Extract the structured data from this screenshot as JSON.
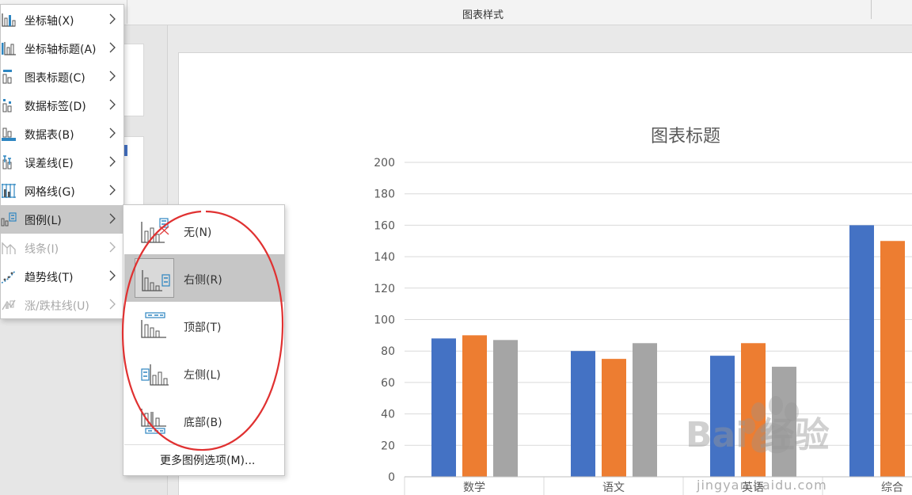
{
  "ribbon": {
    "group_label": "图表样式"
  },
  "menu": {
    "items": [
      {
        "label": "坐标轴(X)",
        "icon": "axis-icon",
        "state": "normal"
      },
      {
        "label": "坐标轴标题(A)",
        "icon": "axis-title-icon",
        "state": "normal"
      },
      {
        "label": "图表标题(C)",
        "icon": "chart-title-icon",
        "state": "normal"
      },
      {
        "label": "数据标签(D)",
        "icon": "data-labels-icon",
        "state": "normal"
      },
      {
        "label": "数据表(B)",
        "icon": "data-table-icon",
        "state": "normal"
      },
      {
        "label": "误差线(E)",
        "icon": "error-bars-icon",
        "state": "normal"
      },
      {
        "label": "网格线(G)",
        "icon": "gridlines-icon",
        "state": "normal"
      },
      {
        "label": "图例(L)",
        "icon": "legend-icon",
        "state": "active"
      },
      {
        "label": "线条(I)",
        "icon": "lines-icon",
        "state": "disabled"
      },
      {
        "label": "趋势线(T)",
        "icon": "trendline-icon",
        "state": "normal"
      },
      {
        "label": "涨/跌柱线(U)",
        "icon": "up-down-bars-icon",
        "state": "disabled"
      }
    ]
  },
  "legend_submenu": {
    "items": [
      {
        "label": "无(N)",
        "icon": "legend-none-icon",
        "state": "normal"
      },
      {
        "label": "右侧(R)",
        "icon": "legend-right-icon",
        "state": "active"
      },
      {
        "label": "顶部(T)",
        "icon": "legend-top-icon",
        "state": "normal"
      },
      {
        "label": "左侧(L)",
        "icon": "legend-left-icon",
        "state": "normal"
      },
      {
        "label": "底部(B)",
        "icon": "legend-bottom-icon",
        "state": "normal"
      }
    ],
    "more_options": "更多图例选项(M)..."
  },
  "chart_data": {
    "type": "bar",
    "title": "图表标题",
    "categories": [
      "数学",
      "语文",
      "英语",
      "综合"
    ],
    "series": [
      {
        "values": [
          88,
          80,
          77,
          160
        ],
        "color": "#4472c4"
      },
      {
        "values": [
          90,
          75,
          85,
          150
        ],
        "color": "#ed7d31"
      },
      {
        "values": [
          87,
          85,
          70,
          null
        ],
        "color": "#a5a5a5"
      }
    ],
    "ylim": [
      0,
      200
    ],
    "yticks": [
      "0",
      "20",
      "40",
      "60",
      "80",
      "100",
      "120",
      "140",
      "160",
      "180",
      "200"
    ],
    "grid": true
  },
  "colors": {
    "accent_blue": "#4472c4",
    "accent_orange": "#ed7d31",
    "accent_gray": "#a5a5a5",
    "annotation_red": "#e03131"
  },
  "watermark": {
    "brand": "Bai 经验",
    "url": "jingyan.baidu.com"
  }
}
